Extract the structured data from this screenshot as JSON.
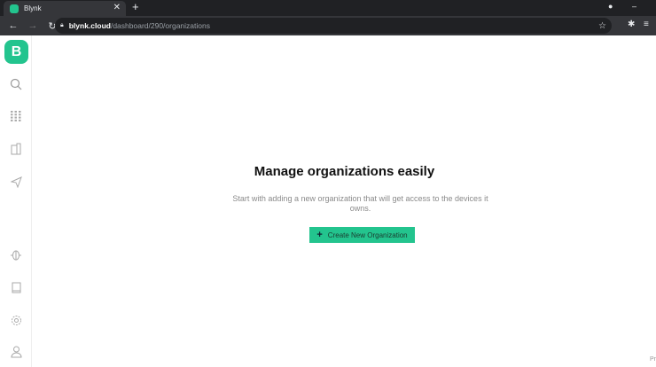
{
  "browser": {
    "tab_title": "Blynk",
    "url_host": "blynk.cloud",
    "url_path": "/dashboard/290/organizations"
  },
  "sidebar": {
    "logo": "B",
    "items": [
      "search",
      "devices",
      "organizations",
      "messages",
      "bug",
      "documentation",
      "settings",
      "profile"
    ]
  },
  "main": {
    "title": "Manage organizations easily",
    "subtitle": "Start with adding a new organization that will get access to the devices it owns.",
    "button_label": "Create New Organization",
    "button_icon": "+"
  },
  "footer_clip": "Pr",
  "colors": {
    "accent": "#23c48e"
  }
}
